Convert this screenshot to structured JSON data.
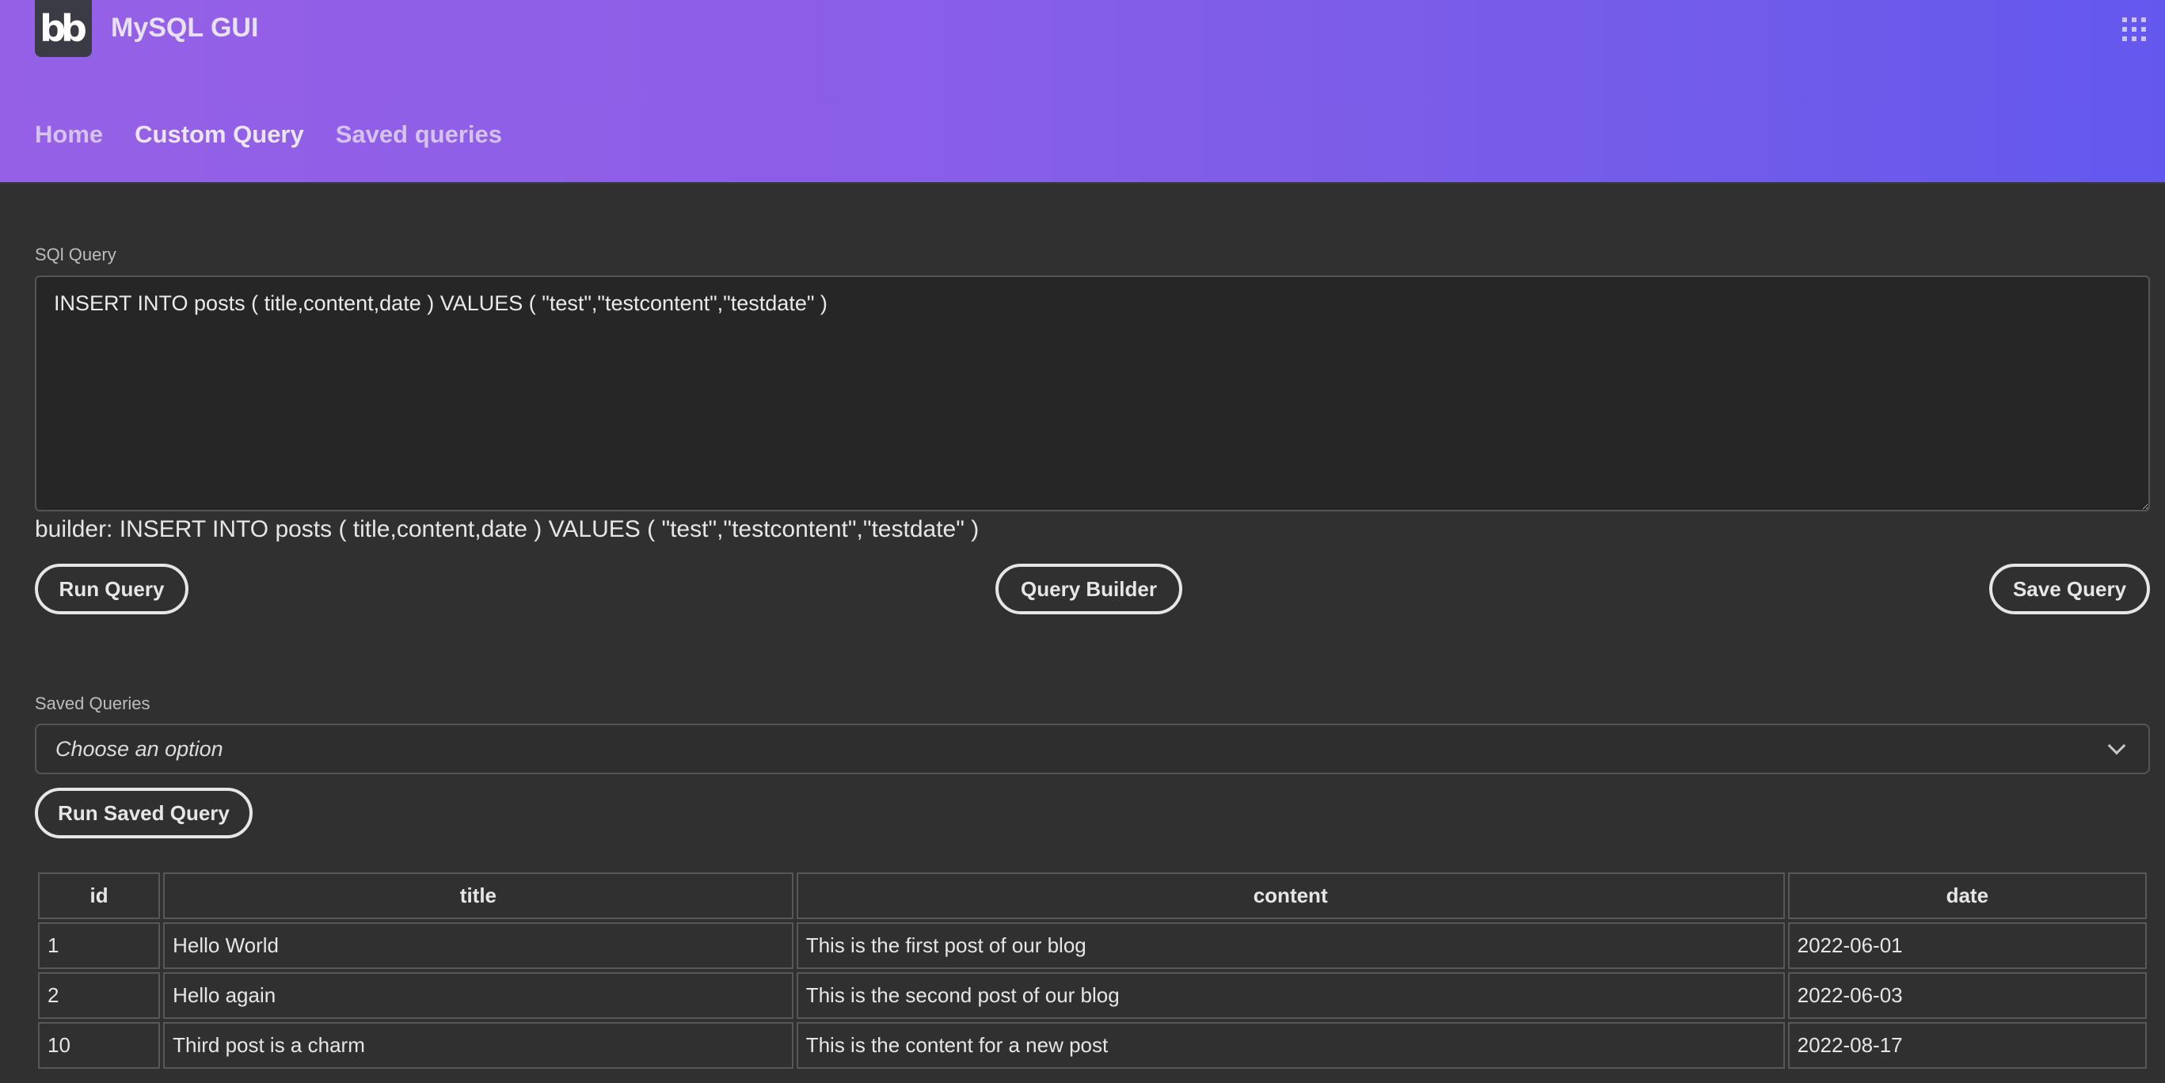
{
  "header": {
    "logo_text": "bb",
    "app_title": "MySQL GUI",
    "apps_icon": "grid-apps-icon",
    "nav": [
      {
        "label": "Home",
        "active": false
      },
      {
        "label": "Custom Query",
        "active": true
      },
      {
        "label": "Saved queries",
        "active": false
      }
    ]
  },
  "query": {
    "label": "SQl Query",
    "value": "INSERT INTO posts ( title,content,date ) VALUES ( \"test\",\"testcontent\",\"testdate\" )",
    "builder_line": "builder: INSERT INTO posts ( title,content,date ) VALUES ( \"test\",\"testcontent\",\"testdate\" )",
    "run_label": "Run Query",
    "builder_label": "Query Builder",
    "save_label": "Save Query"
  },
  "saved": {
    "label": "Saved Queries",
    "placeholder": "Choose an option",
    "run_label": "Run Saved Query"
  },
  "results": {
    "columns": [
      "id",
      "title",
      "content",
      "date"
    ],
    "rows": [
      [
        "1",
        "Hello World",
        "This is the first post of our blog",
        "2022-06-01"
      ],
      [
        "2",
        "Hello again",
        "This is the second post of our blog",
        "2022-06-03"
      ],
      [
        "10",
        "Third post is a charm",
        "This is the content for a new post",
        "2022-08-17"
      ]
    ]
  },
  "colors": {
    "header_gradient_start": "#9560e6",
    "header_gradient_end": "#6358ee",
    "page_background": "#303030",
    "textarea_background": "#262626"
  }
}
